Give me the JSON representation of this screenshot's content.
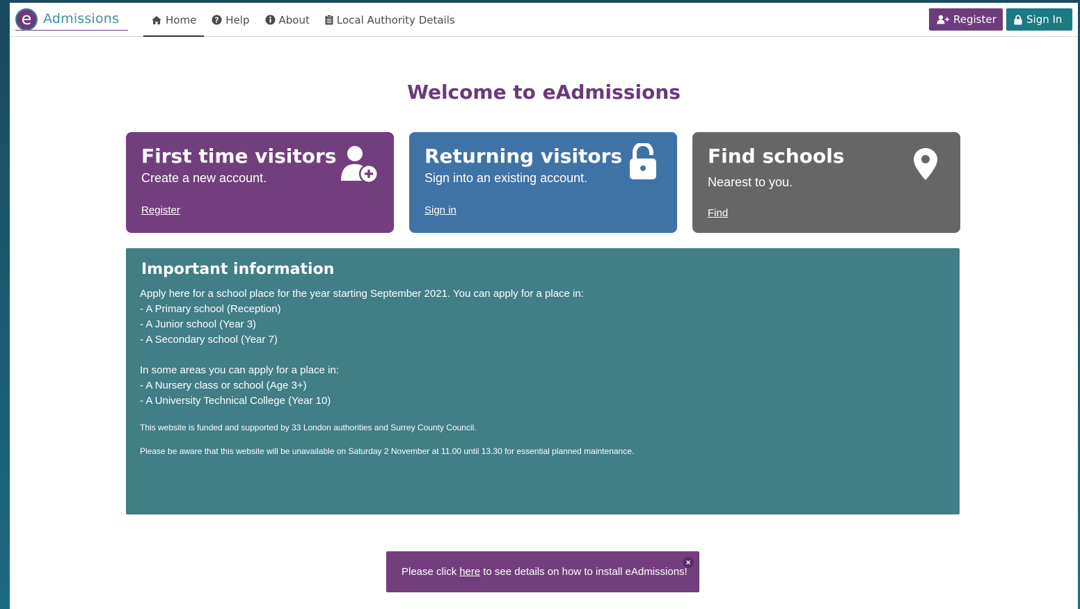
{
  "brand": {
    "letter": "e",
    "name": "Admissions"
  },
  "nav": {
    "items": [
      {
        "label": "Home",
        "icon": "home-icon"
      },
      {
        "label": "Help",
        "icon": "question-circle-icon"
      },
      {
        "label": "About",
        "icon": "info-circle-icon"
      },
      {
        "label": "Local Authority Details",
        "icon": "clipboard-icon"
      }
    ],
    "register_label": "Register",
    "signin_label": "Sign In"
  },
  "welcome": "Welcome to eAdmissions",
  "cards": [
    {
      "title": "First time visitors",
      "subtitle": "Create a new account.",
      "link": "Register",
      "icon": "user-plus-icon",
      "color": "#733e7e"
    },
    {
      "title": "Returning visitors",
      "subtitle": "Sign into an existing account.",
      "link": "Sign in",
      "icon": "lock-icon",
      "color": "#3f73a5"
    },
    {
      "title": "Find schools",
      "subtitle": "Nearest to you.",
      "link": "Find",
      "icon": "map-marker-icon",
      "color": "#666666"
    }
  ],
  "info": {
    "title": "Important information",
    "lines": [
      "Apply here for a school place for the year starting September 2021. You can apply for a place in:",
      "- A Primary school (Reception)",
      "- A Junior school (Year 3)",
      "- A Secondary school (Year 7)",
      "In some areas you can apply for a place in:",
      "- A Nursery class or school (Age 3+)",
      "- A University Technical College (Year 10)"
    ],
    "funding": "This website is funded and supported by 33 London authorities and Surrey County Council.",
    "maintenance": "Please be aware that this website will be unavailable on Saturday 2 November at 11.00 until 13.30 for essential planned maintenance."
  },
  "toast": {
    "prefix": "Please click",
    "link": "here",
    "suffix": "to see details on how to install eAdmissions!",
    "close": "×"
  },
  "colors": {
    "purple": "#733e7e",
    "teal": "#1c7a82",
    "info_bg": "#417e86"
  }
}
